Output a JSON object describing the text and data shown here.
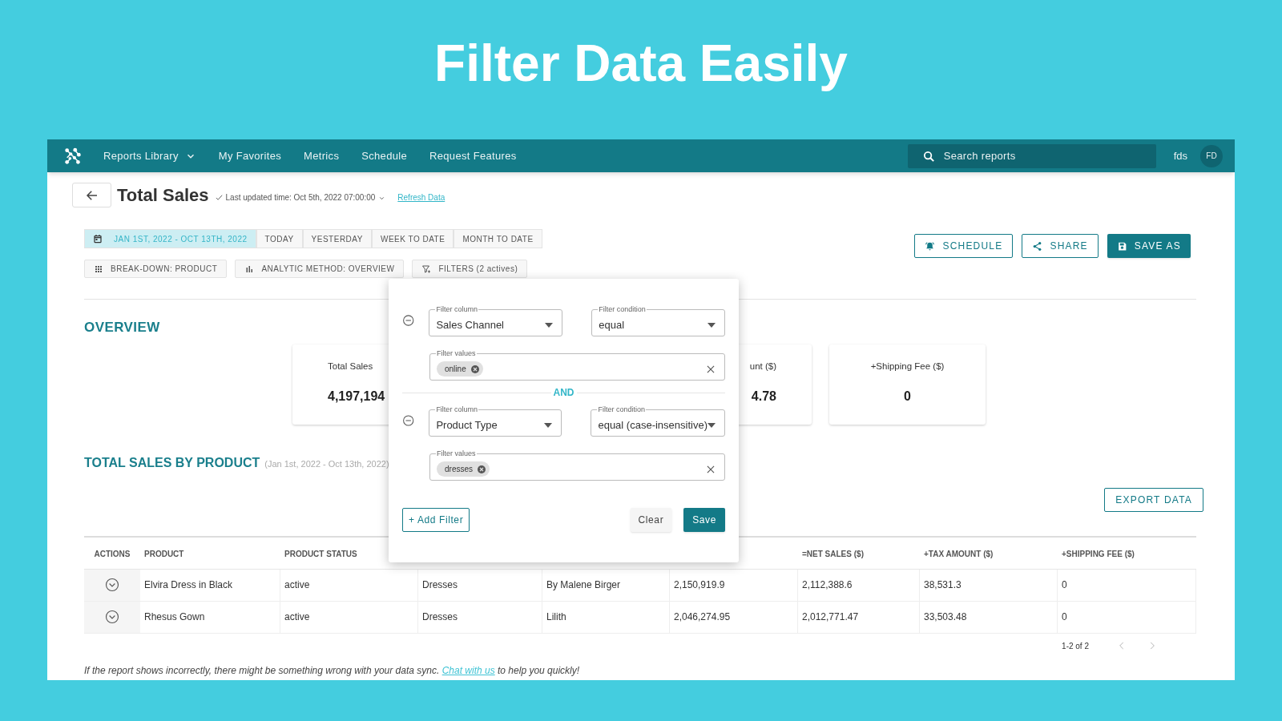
{
  "headline": "Filter Data Easily",
  "nav": {
    "items": [
      {
        "label": "Reports Library",
        "dropdown": true
      },
      {
        "label": "My Favorites",
        "dropdown": false
      },
      {
        "label": "Metrics",
        "dropdown": false
      },
      {
        "label": "Schedule",
        "dropdown": false
      },
      {
        "label": "Request Features",
        "dropdown": false
      }
    ],
    "search": {
      "placeholder": "Search reports"
    },
    "user": "fds",
    "avatar": "FD"
  },
  "header": {
    "title": "Total Sales",
    "updated": "Last updated time: Oct 5th, 2022 07:00:00",
    "refresh_link": "Refresh Data"
  },
  "date_ranges": [
    {
      "label": "JAN 1ST, 2022 - OCT 13TH, 2022",
      "selected": true
    },
    {
      "label": "TODAY",
      "selected": false
    },
    {
      "label": "YESTERDAY",
      "selected": false
    },
    {
      "label": "WEEK TO DATE",
      "selected": false
    },
    {
      "label": "MONTH TO DATE",
      "selected": false
    }
  ],
  "options": [
    {
      "kind": "breakdown",
      "label": "BREAK-DOWN: PRODUCT"
    },
    {
      "kind": "analytic",
      "label": "ANALYTIC METHOD: OVERVIEW"
    },
    {
      "kind": "filters",
      "label": "FILTERS (2 actives)"
    }
  ],
  "actions": [
    {
      "kind": "schedule",
      "label": "SCHEDULE"
    },
    {
      "kind": "share",
      "label": "SHARE"
    },
    {
      "kind": "save",
      "label": "SAVE AS"
    }
  ],
  "overview": {
    "title": "OVERVIEW",
    "cards": [
      {
        "label": "Total Sales",
        "value": "4,197,194",
        "kind": "cutright"
      },
      {
        "label": "unt ($)",
        "value": "4.78",
        "kind": "cutleft"
      },
      {
        "label": "+Shipping Fee ($)",
        "value": "0",
        "kind": "whole"
      }
    ]
  },
  "table_section": {
    "title": "TOTAL SALES BY PRODUCT",
    "range": "(Jan 1st, 2022 - Oct 13th, 2022)",
    "export": "EXPORT DATA"
  },
  "table": {
    "columns": [
      {
        "label": "ACTIONS"
      },
      {
        "label": "PRODUCT"
      },
      {
        "label": "PRODUCT STATUS"
      },
      {},
      {},
      {},
      {
        "label": "=NET SALES ($)"
      },
      {
        "label": "+TAX AMOUNT ($)"
      },
      {
        "label": "+SHIPPING FEE ($)"
      }
    ],
    "rows": [
      {
        "cells": [
          "",
          "Elvira Dress in Black",
          "active",
          "Dresses",
          "By Malene Birger",
          "2,150,919.9",
          "2,112,388.6",
          "38,531.3",
          "0"
        ]
      },
      {
        "cells": [
          "",
          "Rhesus Gown",
          "active",
          "Dresses",
          "Lilith",
          "2,046,274.95",
          "2,012,771.47",
          "33,503.48",
          "0"
        ]
      }
    ]
  },
  "pagination": {
    "range": "1-2 of 2"
  },
  "footer": {
    "before": "If the report shows incorrectly, there might be something wrong with your data sync.",
    "link": "Chat with us",
    "after": "to help you quickly!"
  },
  "filter_panel": {
    "filters": [
      {
        "column_label": "Filter column",
        "column": "Sales Channel",
        "condition_label": "Filter condition",
        "condition": "equal",
        "values_label": "Filter values",
        "values": [
          "online"
        ]
      },
      {
        "column_label": "Filter column",
        "column": "Product Type",
        "condition_label": "Filter condition",
        "condition": "equal (case-insensitive)",
        "values_label": "Filter values",
        "values": [
          "dresses"
        ]
      }
    ],
    "joiner": "AND",
    "add_button": "+ Add Filter",
    "clear_button": "Clear",
    "save_button": "Save"
  }
}
